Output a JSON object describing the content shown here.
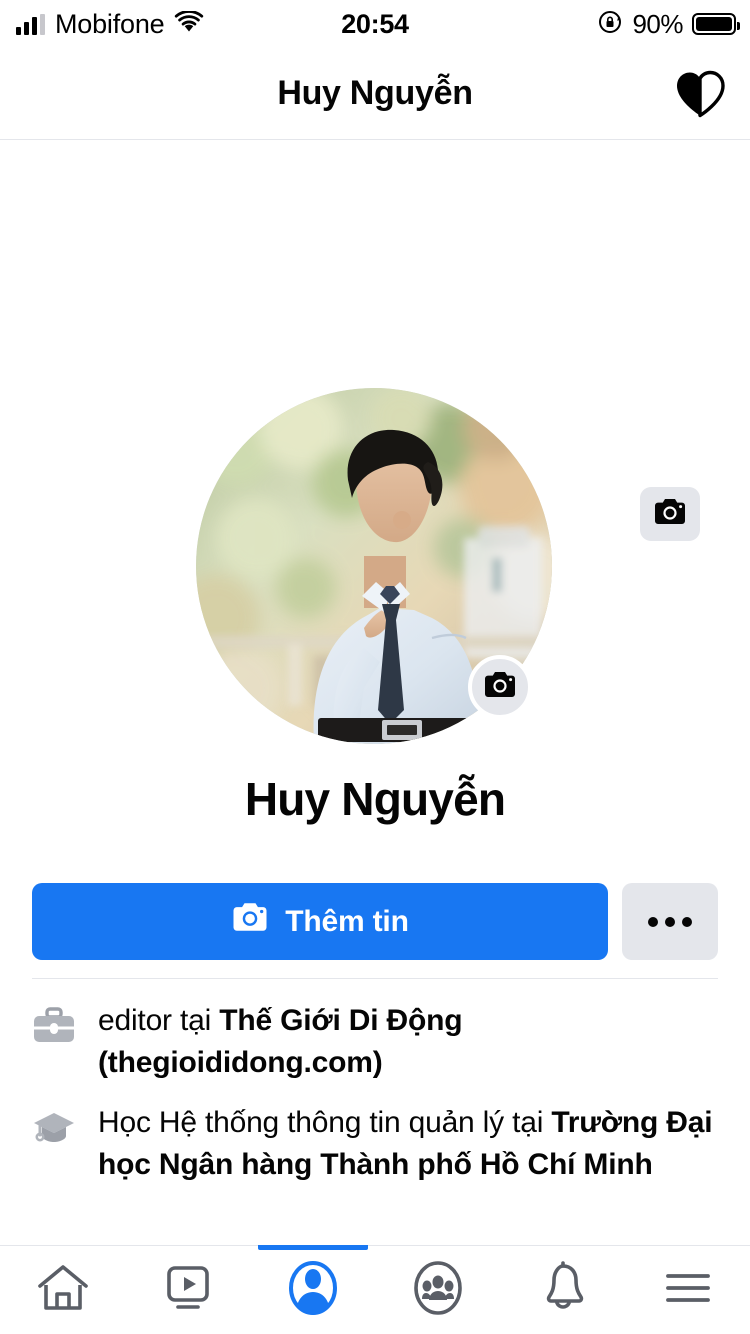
{
  "status_bar": {
    "carrier": "Mobifone",
    "time": "20:54",
    "battery_percent": "90%",
    "signal_icon": "signal-bars-icon",
    "wifi_icon": "wifi-icon",
    "rotation_lock_icon": "rotation-lock-icon",
    "battery_icon": "battery-icon"
  },
  "header": {
    "title": "Huy Nguyễn",
    "right_icon": "half-heart-icon"
  },
  "cover": {
    "edit_cover_icon": "camera-icon"
  },
  "profile": {
    "name": "Huy Nguyễn",
    "avatar_alt": "Huy Nguyễn profile photo",
    "edit_avatar_icon": "camera-icon"
  },
  "actions": {
    "primary_label": "Thêm tin",
    "primary_icon": "camera-icon",
    "primary_color": "#1877f2",
    "more_icon": "ellipsis-icon",
    "more_color": "#e4e6eb"
  },
  "details": [
    {
      "icon": "briefcase-icon",
      "prefix": "editor tại ",
      "highlight": "Thế Giới Di Động (thegioididong.com)"
    },
    {
      "icon": "graduation-cap-icon",
      "prefix": "Học Hệ thống thông tin quản lý tại ",
      "highlight": "Trường Đại học Ngân hàng Thành phố Hồ Chí Minh"
    }
  ],
  "tabbar": {
    "active_index": 2,
    "active_color": "#1877f2",
    "items": [
      {
        "name": "home",
        "icon": "home-icon"
      },
      {
        "name": "watch",
        "icon": "video-play-icon"
      },
      {
        "name": "profile",
        "icon": "profile-avatar-icon"
      },
      {
        "name": "groups",
        "icon": "groups-icon"
      },
      {
        "name": "notifications",
        "icon": "bell-icon"
      },
      {
        "name": "menu",
        "icon": "hamburger-menu-icon"
      }
    ]
  }
}
